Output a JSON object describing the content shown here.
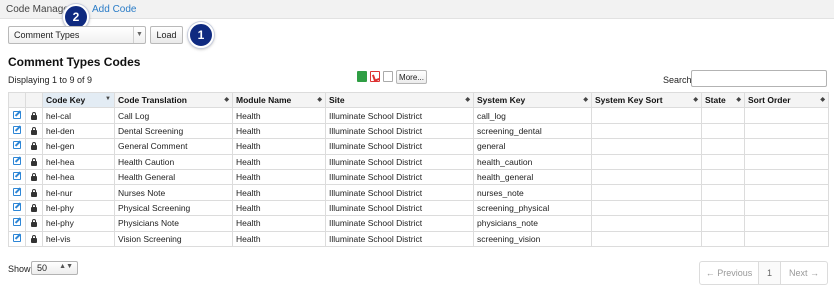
{
  "topbar": {
    "breadcrumb": "Code Manager",
    "add_link": "Add Code"
  },
  "steps": {
    "one": "1",
    "two": "2"
  },
  "toolbar": {
    "select_value": "Comment Types",
    "load_label": "Load"
  },
  "header": {
    "title": "Comment Types Codes",
    "displaying": "Displaying 1 to 9 of 9"
  },
  "export": {
    "more_label": "More...",
    "search_label": "Search",
    "search_value": ""
  },
  "table": {
    "columns": [
      "",
      "",
      "Code Key",
      "Code Translation",
      "Module Name",
      "Site",
      "System Key",
      "System Key Sort",
      "State",
      "Sort Order"
    ],
    "rows": [
      [
        "hel-cal",
        "Call Log",
        "Health",
        "Illuminate School District",
        "call_log",
        "",
        "",
        ""
      ],
      [
        "hel-den",
        "Dental Screening",
        "Health",
        "Illuminate School District",
        "screening_dental",
        "",
        "",
        ""
      ],
      [
        "hel-gen",
        "General Comment",
        "Health",
        "Illuminate School District",
        "general",
        "",
        "",
        ""
      ],
      [
        "hel-hea",
        "Health Caution",
        "Health",
        "Illuminate School District",
        "health_caution",
        "",
        "",
        ""
      ],
      [
        "hel-hea",
        "Health General",
        "Health",
        "Illuminate School District",
        "health_general",
        "",
        "",
        ""
      ],
      [
        "hel-nur",
        "Nurses Note",
        "Health",
        "Illuminate School District",
        "nurses_note",
        "",
        "",
        ""
      ],
      [
        "hel-phy",
        "Physical Screening",
        "Health",
        "Illuminate School District",
        "screening_physical",
        "",
        "",
        ""
      ],
      [
        "hel-phy",
        "Physicians Note",
        "Health",
        "Illuminate School District",
        "physicians_note",
        "",
        "",
        ""
      ],
      [
        "hel-vis",
        "Vision Screening",
        "Health",
        "Illuminate School District",
        "screening_vision",
        "",
        "",
        ""
      ]
    ]
  },
  "footer": {
    "show_label": "Show",
    "show_value": "50",
    "prev_label": "← Previous",
    "page": "1",
    "next_label": "Next →"
  },
  "colors": {
    "accent": "#2a7cc7",
    "step_badge": "#0f2a80",
    "sorted_header": "#e3ecf4"
  }
}
